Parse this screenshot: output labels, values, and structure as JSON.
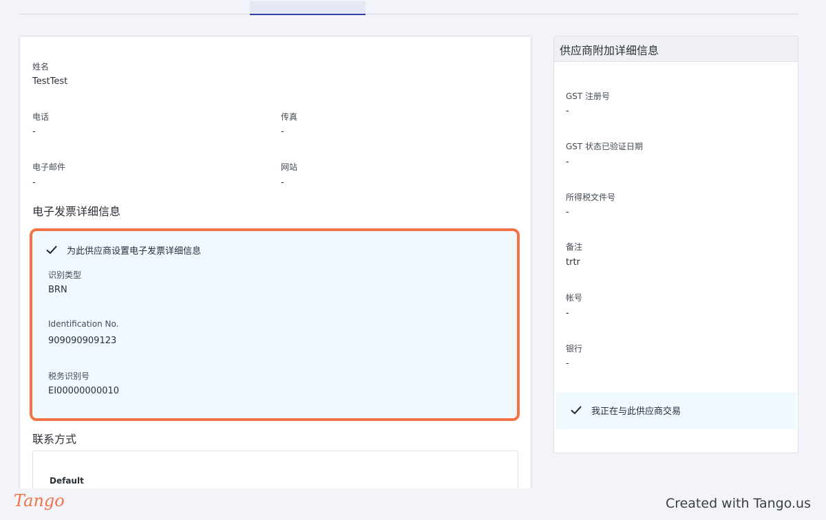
{
  "main": {
    "name": {
      "label": "姓名",
      "value": "TestTest"
    },
    "phone": {
      "label": "电话",
      "value": "-"
    },
    "fax": {
      "label": "传真",
      "value": "-"
    },
    "email": {
      "label": "电子邮件",
      "value": "-"
    },
    "website": {
      "label": "网站",
      "value": "-"
    },
    "einvoice_title": "电子发票详细信息",
    "einvoice": {
      "checkbox_label": "为此供应商设置电子发票详细信息",
      "id_type": {
        "label": "识别类型",
        "value": "BRN"
      },
      "id_no": {
        "label": "Identification No.",
        "value": "909090909123"
      },
      "tax_id": {
        "label": "税务识别号",
        "value": "EI00000000010"
      }
    },
    "contact_title": "联系方式",
    "contact_default_label": "Default"
  },
  "side": {
    "title": "供应商附加详细信息",
    "fields": [
      {
        "label": "GST 注册号",
        "value": "-"
      },
      {
        "label": "GST 状态已验证日期",
        "value": "-"
      },
      {
        "label": "所得税文件号",
        "value": "-"
      },
      {
        "label": "备注",
        "value": "trtr"
      },
      {
        "label": "帐号",
        "value": "-"
      },
      {
        "label": "银行",
        "value": "-"
      }
    ],
    "trading_label": "我正在与此供应商交易"
  },
  "footer": {
    "logo": "Tango",
    "created": "Created with Tango.us"
  },
  "colors": {
    "highlight": "#f47346",
    "tab_indicator": "#2f3da6",
    "light_blue": "#f0f9fd"
  }
}
